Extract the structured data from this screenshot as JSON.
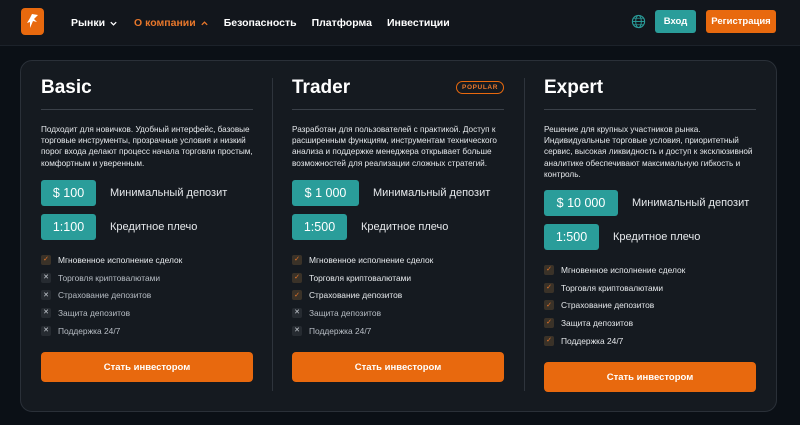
{
  "header": {
    "nav": [
      {
        "label": "Рынки",
        "has_chevron": true,
        "active": false
      },
      {
        "label": "О компании",
        "has_chevron": true,
        "active": true
      },
      {
        "label": "Безопасность",
        "has_chevron": false,
        "active": false
      },
      {
        "label": "Платформа",
        "has_chevron": false,
        "active": false
      },
      {
        "label": "Инвестиции",
        "has_chevron": false,
        "active": false
      }
    ],
    "login_label": "Вход",
    "register_label": "Регистрация"
  },
  "plans": [
    {
      "name": "Basic",
      "badge": "",
      "description": "Подходит для новичков. Удобный интерфейс, базовые торговые инструменты, прозрачные условия и низкий порог входа делают процесс начала торговли простым, комфортным и уверенным.",
      "deposit_value": "$ 100",
      "deposit_label": "Минимальный депозит",
      "leverage_value": "1:100",
      "leverage_label": "Кредитное плечо",
      "features": [
        {
          "label": "Мгновенное исполнение сделок",
          "included": true
        },
        {
          "label": "Торговля криптовалютами",
          "included": false
        },
        {
          "label": "Страхование депозитов",
          "included": false
        },
        {
          "label": "Защита депозитов",
          "included": false
        },
        {
          "label": "Поддержка 24/7",
          "included": false
        }
      ],
      "cta": "Стать инвестором"
    },
    {
      "name": "Trader",
      "badge": "POPULAR",
      "description": "Разработан для пользователей с практикой. Доступ к расширенным функциям, инструментам технического анализа и поддержке менеджера открывает больше возможностей для реализации сложных стратегий.",
      "deposit_value": "$ 1 000",
      "deposit_label": "Минимальный депозит",
      "leverage_value": "1:500",
      "leverage_label": "Кредитное плечо",
      "features": [
        {
          "label": "Мгновенное исполнение сделок",
          "included": true
        },
        {
          "label": "Торговля криптовалютами",
          "included": true
        },
        {
          "label": "Страхование депозитов",
          "included": true
        },
        {
          "label": "Защита депозитов",
          "included": false
        },
        {
          "label": "Поддержка 24/7",
          "included": false
        }
      ],
      "cta": "Стать инвестором"
    },
    {
      "name": "Expert",
      "badge": "",
      "description": "Решение для крупных участников рынка. Индивидуальные торговые условия, приоритетный сервис, высокая ликвидность и доступ к эксклюзивной аналитике обеспечивают максимальную гибкость и контроль.",
      "deposit_value": "$ 10 000",
      "deposit_label": "Минимальный депозит",
      "leverage_value": "1:500",
      "leverage_label": "Кредитное плечо",
      "features": [
        {
          "label": "Мгновенное исполнение сделок",
          "included": true
        },
        {
          "label": "Торговля криптовалютами",
          "included": true
        },
        {
          "label": "Страхование депозитов",
          "included": true
        },
        {
          "label": "Защита депозитов",
          "included": true
        },
        {
          "label": "Поддержка 24/7",
          "included": true
        }
      ],
      "cta": "Стать инвестором"
    }
  ],
  "colors": {
    "accent": "#e8690e",
    "teal": "#2a9d9a",
    "background": "#0b1016",
    "panel": "#151a20"
  },
  "icons": {
    "logo": "brand-logo-icon",
    "globe": "globe-icon",
    "included": "check-icon",
    "excluded": "cross-icon"
  }
}
